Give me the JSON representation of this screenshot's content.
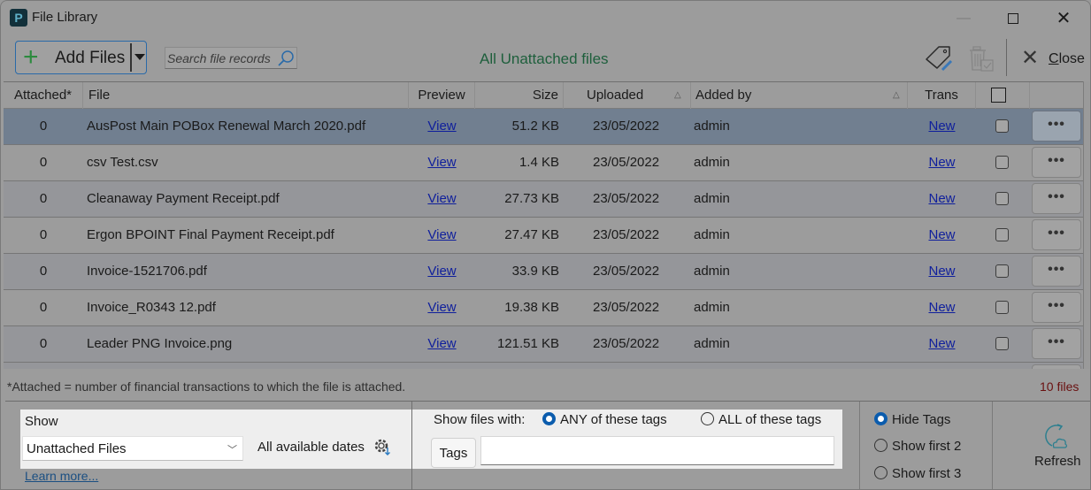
{
  "window": {
    "title": "File Library",
    "app_icon": "P",
    "controls": {
      "minimize": "—",
      "maximize": "maximize-icon",
      "close": "✕"
    }
  },
  "toolbar": {
    "add_files_label": "Add Files",
    "search_placeholder": "Search file records",
    "heading": "All Unattached files",
    "close_label_first": "C",
    "close_label_rest": "lose",
    "icons": [
      "tag-edit-icon",
      "delete-checked-icon",
      "close-icon"
    ]
  },
  "grid": {
    "columns": {
      "attached": "Attached*",
      "file": "File",
      "preview": "Preview",
      "size": "Size",
      "uploaded": "Uploaded",
      "added_by": "Added by",
      "trans": "Trans"
    },
    "rows": [
      {
        "attached": "0",
        "file": "AusPost Main POBox Renewal March 2020.pdf",
        "preview": "View",
        "size": "51.2 KB",
        "uploaded": "23/05/2022",
        "added_by": "admin",
        "trans": "New",
        "more": "•••",
        "selected": true
      },
      {
        "attached": "0",
        "file": "csv Test.csv",
        "preview": "View",
        "size": "1.4 KB",
        "uploaded": "23/05/2022",
        "added_by": "admin",
        "trans": "New",
        "more": "•••"
      },
      {
        "attached": "0",
        "file": "Cleanaway Payment Receipt.pdf",
        "preview": "View",
        "size": "27.73 KB",
        "uploaded": "23/05/2022",
        "added_by": "admin",
        "trans": "New",
        "more": "•••"
      },
      {
        "attached": "0",
        "file": "Ergon BPOINT Final Payment Receipt.pdf",
        "preview": "View",
        "size": "27.47 KB",
        "uploaded": "23/05/2022",
        "added_by": "admin",
        "trans": "New",
        "more": "•••"
      },
      {
        "attached": "0",
        "file": "Invoice-1521706.pdf",
        "preview": "View",
        "size": "33.9 KB",
        "uploaded": "23/05/2022",
        "added_by": "admin",
        "trans": "New",
        "more": "•••"
      },
      {
        "attached": "0",
        "file": "Invoice_R0343 12.pdf",
        "preview": "View",
        "size": "19.38 KB",
        "uploaded": "23/05/2022",
        "added_by": "admin",
        "trans": "New",
        "more": "•••"
      },
      {
        "attached": "0",
        "file": "Leader PNG Invoice.png",
        "preview": "View",
        "size": "121.51 KB",
        "uploaded": "23/05/2022",
        "added_by": "admin",
        "trans": "New",
        "more": "•••"
      }
    ]
  },
  "footer": {
    "note": "*Attached = number of financial transactions to which the file is attached.",
    "file_count": "10 files",
    "show_label": "Show",
    "show_value": "Unattached Files",
    "dates_label": "All available dates",
    "learn_more": "Learn more...",
    "show_files_with": "Show files with:",
    "tag_match_options": [
      "ANY of these tags",
      "ALL of these tags"
    ],
    "tag_match_selected": "ANY of these tags",
    "tags_button": "Tags",
    "tags_value": "",
    "tag_display_options": [
      "Hide Tags",
      "Show first 2",
      "Show first 3"
    ],
    "tag_display_selected": "Hide Tags",
    "refresh_label": "Refresh"
  },
  "colors": {
    "accent": "#0b5cad",
    "heading_green": "#1e5f3c",
    "link": "#0f1f9c",
    "count_red": "#6a1010",
    "selected_row": "#717f90"
  }
}
